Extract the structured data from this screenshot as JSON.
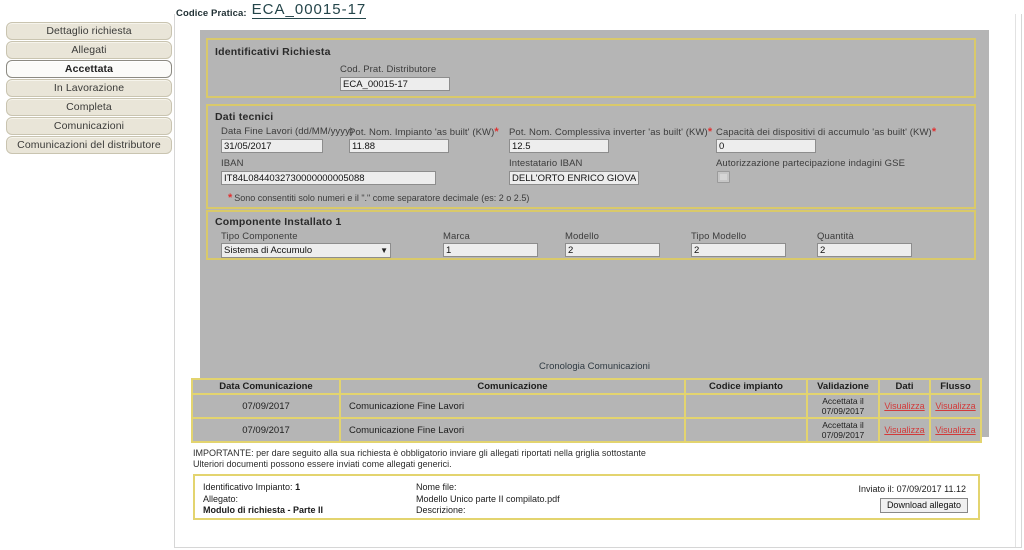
{
  "sidebar": {
    "items": [
      {
        "label": "Dettaglio richiesta",
        "active": false
      },
      {
        "label": "Allegati",
        "active": false
      },
      {
        "label": "Accettata",
        "active": true
      },
      {
        "label": "In Lavorazione",
        "active": false
      },
      {
        "label": "Completa",
        "active": false
      },
      {
        "label": "Comunicazioni",
        "active": false
      },
      {
        "label": "Comunicazioni del distributore",
        "active": false
      }
    ]
  },
  "header": {
    "label": "Codice Pratica:",
    "code": "ECA_00015-17"
  },
  "sections": {
    "identificativi": {
      "title": "Identificativi Richiesta",
      "cod_prat_label": "Cod. Prat. Distributore",
      "cod_prat_value": "ECA_00015-17"
    },
    "dati_tecnici": {
      "title": "Dati tecnici",
      "data_fine_lavori_label": "Data Fine Lavori (dd/MM/yyyy)",
      "data_fine_lavori_value": "31/05/2017",
      "pot_nom_impianto_label": "Pot. Nom. Impianto 'as built' (KW)",
      "pot_nom_impianto_value": "11.88",
      "pot_nom_inverter_label": "Pot. Nom. Complessiva inverter 'as built' (KW)",
      "pot_nom_inverter_value": "12.5",
      "capacita_accumulo_label": "Capacità dei dispositivi di accumulo 'as built' (KW)",
      "capacita_accumulo_value": "0",
      "iban_label": "IBAN",
      "iban_value": "IT84L0844032730000000005088",
      "intestatario_label": "Intestatario IBAN",
      "intestatario_value": "DELL'ORTO ENRICO GIOVAN",
      "autorizzazione_label": "Autorizzazione partecipazione indagini GSE",
      "hint": "Sono consentiti solo numeri e il \".\" come separatore decimale (es: 2 o 2.5)",
      "required_marker": "*"
    },
    "componente": {
      "title": "Componente Installato  1",
      "tipo_label": "Tipo Componente",
      "tipo_value": "Sistema di Accumulo",
      "marca_label": "Marca",
      "marca_value": "1",
      "modello_label": "Modello",
      "modello_value": "2",
      "tipo_modello_label": "Tipo Modello",
      "tipo_modello_value": "2",
      "quantita_label": "Quantità",
      "quantita_value": "2"
    }
  },
  "cronologia": {
    "caption": "Cronologia Comunicazioni",
    "columns": [
      "Data Comunicazione",
      "Comunicazione",
      "Codice impianto",
      "Validazione",
      "Dati",
      "Flusso"
    ],
    "rows": [
      {
        "data": "07/09/2017",
        "comunicazione": "Comunicazione Fine Lavori",
        "codice_impianto": "",
        "validazione": "Accettata il 07/09/2017",
        "dati": "Visualizza",
        "flusso": "Visualizza"
      },
      {
        "data": "07/09/2017",
        "comunicazione": "Comunicazione Fine Lavori",
        "codice_impianto": "",
        "validazione": "Accettata il 07/09/2017",
        "dati": "Visualizza",
        "flusso": "Visualizza"
      }
    ]
  },
  "note": {
    "line1": "IMPORTANTE: per dare seguito alla sua richiesta è obbligatorio inviare gli allegati riportati nella griglia sottostante",
    "line2": "Ulteriori documenti possono essere inviati come allegati generici."
  },
  "attachment": {
    "id_label": "Identificativo Impianto:",
    "id_value": "1",
    "allegato_label": "Allegato:",
    "allegato_value": "Modulo di richiesta - Parte II",
    "nome_file_label": "Nome file:",
    "nome_file_value": "Modello Unico parte II compilato.pdf",
    "descrizione_label": "Descrizione:",
    "descrizione_value": "",
    "inviato_label": "Inviato il:",
    "inviato_value": "07/09/2017 11.12",
    "download_button": "Download allegato"
  },
  "colors": {
    "accent_gold": "#e3d46f",
    "panel_gray": "#b5b5b5",
    "link_red": "#d23a3a",
    "title_teal": "#24454a"
  }
}
